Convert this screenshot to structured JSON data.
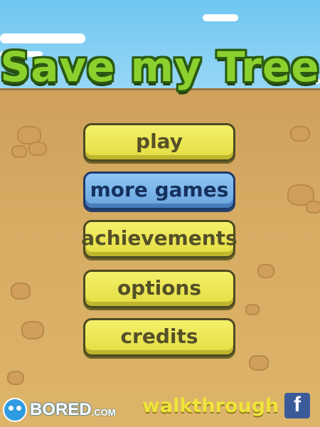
{
  "title": "Save my Tree",
  "menu": {
    "play": "play",
    "more_games": "more games",
    "achievements": "achievements",
    "options": "options",
    "credits": "credits"
  },
  "footer": {
    "brand": "BORED",
    "brand_suffix": ".COM",
    "walkthrough": "walkthrough",
    "facebook": "f"
  },
  "colors": {
    "title_green": "#8bd12e",
    "button_yellow": "#f4f06a",
    "button_blue": "#8ec6f4",
    "ground": "#d7ac63",
    "sky": "#6fc6f0"
  },
  "icons": [
    "bored-face-icon",
    "facebook-icon"
  ]
}
